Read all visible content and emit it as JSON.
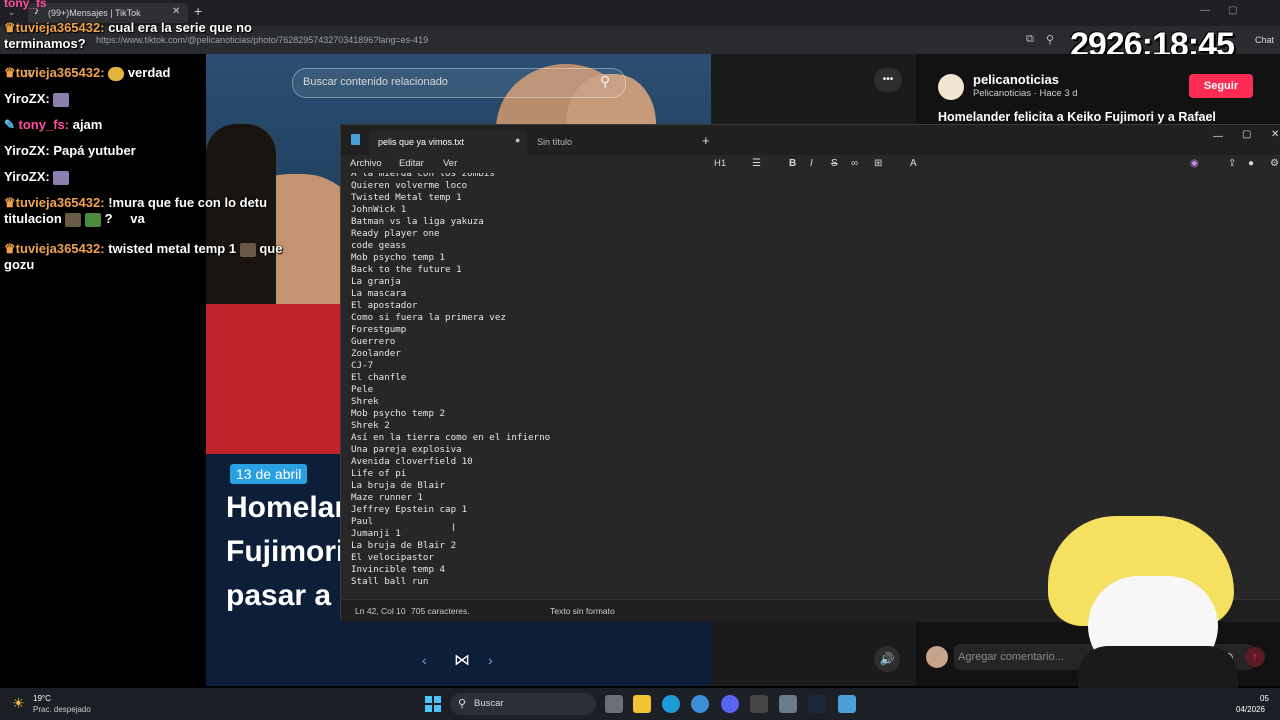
{
  "browser": {
    "tab_title": "(99+)Mensajes | TikTok",
    "new_tab": "+",
    "url": "https://www.tiktok.com/@pelicanoticias/photo/7628295743270341896?lang=es-419",
    "minimize": "—",
    "restore": "▢",
    "chat_label": "Chat"
  },
  "stream_timer": "2926:18:45",
  "chat": {
    "lines": [
      {
        "user": "tuvieja365432:",
        "text": "cual era la serie que no terminamos?"
      },
      {
        "user": "tuvieja365432:",
        "text": "verdad"
      },
      {
        "user": "YiroZX:",
        "text": ""
      },
      {
        "user": "tony_fs:",
        "text": "ajam"
      },
      {
        "user": "YiroZX:",
        "text": "Papá yutuber"
      },
      {
        "user": "YiroZX:",
        "text": ""
      },
      {
        "user": "tuvieja365432:",
        "text": "!mura que fue con lo detu titulacion"
      },
      {
        "user": "tuvieja365432:",
        "text": "twisted metal temp 1"
      }
    ],
    "extras": {
      "question": "?",
      "va": "va",
      "que": "que",
      "gozu": "gozu",
      "top_user": "tony_fs"
    }
  },
  "tiktok": {
    "search_placeholder": "Buscar contenido relacionado",
    "more": "•••",
    "date_badge": "13 de abril",
    "headline_1": "Homelan",
    "headline_2": "Fujimori",
    "headline_3": "pasar a s",
    "author": "pelicanoticias",
    "author_sub": "Pelicanoticias · Hace 3 d",
    "follow": "Seguir",
    "post_title": "Homelander felicita a Keiko Fujimori y a Rafael",
    "comment_placeholder": "Agregar comentario...",
    "close": "✕"
  },
  "notepad": {
    "tab_active": "pelis que ya vimos.txt",
    "tab_other": "Sin título",
    "add_tab": "+",
    "menu": [
      "Archivo",
      "Editar",
      "Ver"
    ],
    "heading": "H1",
    "lines": [
      "A la mierda con los zombis",
      "Quieren volverme loco",
      "Twisted Metal temp 1",
      "JohnWick 1",
      "Batman vs la liga yakuza",
      "Ready player one",
      "code geass",
      "Mob psycho temp 1",
      "Back to the future 1",
      "La granja",
      "La mascara",
      "El apostador",
      "Como si fuera la primera vez",
      "Forestgump",
      "Guerrero",
      "Zoolander",
      "CJ-7",
      "El chanfle",
      "Pele",
      "Shrek",
      "Mob psycho temp 2",
      "Shrek 2",
      "Así en la tierra como en el infierno",
      "Una pareja explosiva",
      "Avenida cloverfield 10",
      "Life of pi",
      "La bruja de Blair",
      "Maze runner 1",
      "Jeffrey Epstein cap 1",
      "Paul",
      "Jumanji 1",
      "La bruja de Blair 2",
      "El velocipastor",
      "Invincible temp 4",
      "Stall ball run"
    ],
    "status_pos": "Ln 42, Col 10",
    "status_chars": "705 caracteres.",
    "status_format": "Texto sin formato"
  },
  "taskbar": {
    "weather_temp": "19°C",
    "weather_desc": "Prac. despejado",
    "search": "Buscar",
    "clock_time": "05",
    "clock_date": "04/2026"
  },
  "colors": {
    "accent_pink": "#fe2c55",
    "chat_user": "#f0a24a",
    "notepad_bg": "#272727"
  }
}
